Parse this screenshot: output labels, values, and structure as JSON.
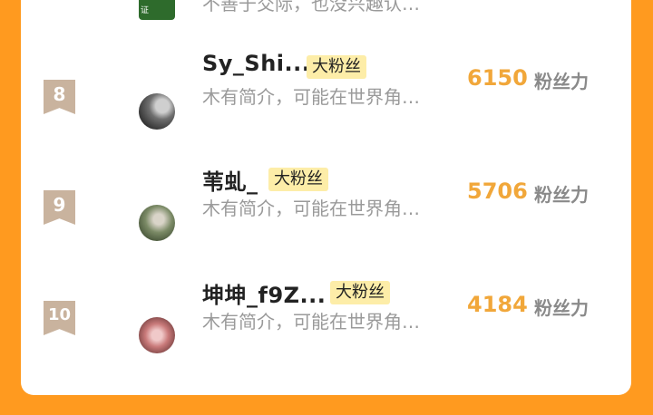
{
  "ranking": {
    "partial_top_row": {
      "avatar_label": "证",
      "bio": "不善于交际，也没兴趣认…"
    },
    "rows": [
      {
        "rank": "8",
        "name": "Sy_Shi...",
        "badge": "大粉丝",
        "bio": "木有简介，可能在世界角…",
        "score": "6150",
        "unit": "粉丝力"
      },
      {
        "rank": "9",
        "name": "苇虬_",
        "badge": "大粉丝",
        "bio": "木有简介，可能在世界角…",
        "score": "5706",
        "unit": "粉丝力"
      },
      {
        "rank": "10",
        "name": "坤坤_f9Z...",
        "badge": "大粉丝",
        "bio": "木有简介，可能在世界角…",
        "score": "4184",
        "unit": "粉丝力"
      }
    ]
  },
  "colors": {
    "page_background": "#FF9A1F",
    "card_background": "#FFFFFF",
    "rank_badge": "#C9B39E",
    "fan_badge": "#FDEDA8",
    "score": "#F1A73A",
    "bio_text": "#9A9A9A"
  }
}
